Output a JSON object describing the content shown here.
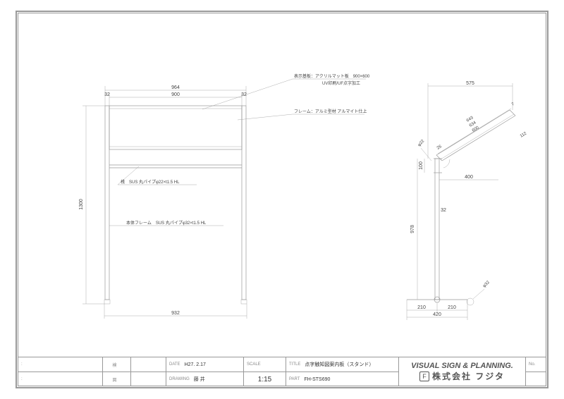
{
  "titleblock": {
    "date_label": "DATE",
    "date": "H27. 2.17",
    "drawing_label": "DRAWING",
    "drawing": "藤 井",
    "scale_label": "SCALE",
    "scale": "1:15",
    "title_label": "TITLE",
    "title": "点字触知図案内板（スタンド）",
    "part_label": "PART",
    "part": "FH-STS690",
    "company_en": "VISUAL  SIGN & PLANNING.",
    "company_jp": "株式会社 フジタ",
    "no_label": "No."
  },
  "dims": {
    "front_width": "964",
    "panel_w": "900",
    "frame_l": "32",
    "frame_r": "32",
    "height": "1300",
    "base_w": "932",
    "side_top": "575",
    "side_h": "978",
    "side_base": "420",
    "side_off_l": "210",
    "side_off_r": "210",
    "side_top_h": "100",
    "side_ext": "400",
    "tube": "32",
    "hole": "φ22",
    "dia": "φ32",
    "ang_a": "26",
    "ang_b": "7",
    "slant_a": "643",
    "slant_b": "634",
    "slant_c": "600",
    "slant_d": "112"
  },
  "notes": {
    "panel": "表示基板：アクリルマット板　900×600",
    "panel2": "UV印刷/UF点字加工",
    "frame": "フレーム：アルミ型材 アルマイト仕上",
    "rail": "桟　SUS 丸パイプφ22×t1.5 HL",
    "body": "本体フレーム　SUS 丸パイプφ32×t1.5 HL"
  }
}
